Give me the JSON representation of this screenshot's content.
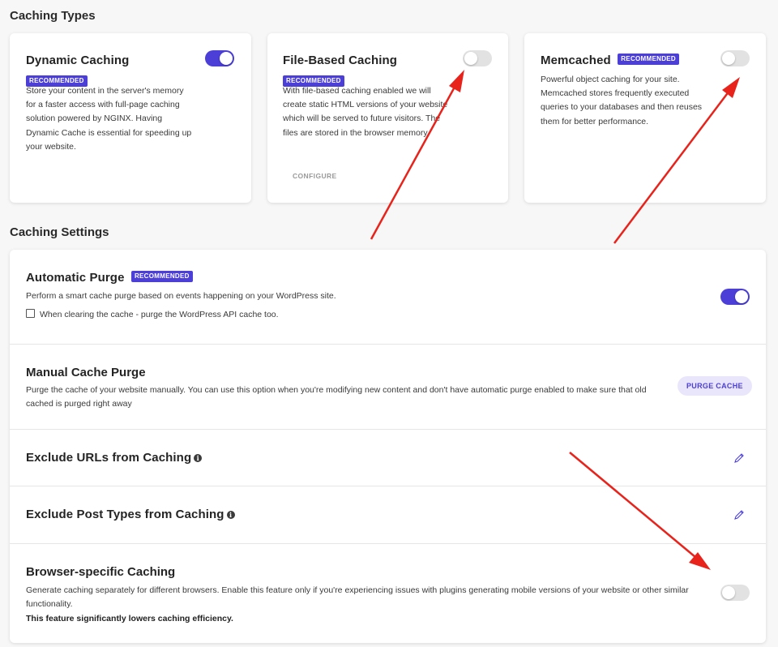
{
  "caching_types": {
    "heading": "Caching Types",
    "cards": [
      {
        "title": "Dynamic Caching",
        "badge": "RECOMMENDED",
        "description": "Store your content in the server's memory for a faster access with full-page caching solution powered by NGINX. Having Dynamic Cache is essential for speeding up your website.",
        "enabled": true
      },
      {
        "title": "File-Based Caching",
        "badge": "RECOMMENDED",
        "description": "With file-based caching enabled we will create static HTML versions of your website which will be served to future visitors. The files are stored in the browser memory.",
        "action_label": "CONFIGURE",
        "enabled": false
      },
      {
        "title": "Memcached",
        "badge": "RECOMMENDED",
        "description": "Powerful object caching for your site. Memcached stores frequently executed queries to your databases and then reuses them for better performance.",
        "enabled": false
      }
    ]
  },
  "caching_settings": {
    "heading": "Caching Settings",
    "automatic_purge": {
      "title": "Automatic Purge",
      "badge": "RECOMMENDED",
      "description": "Perform a smart cache purge based on events happening on your WordPress site.",
      "checkbox_label": "When clearing the cache - purge the WordPress API cache too.",
      "checkbox_checked": false,
      "enabled": true
    },
    "manual_purge": {
      "title": "Manual Cache Purge",
      "description": "Purge the cache of your website manually. You can use this option when you're modifying new content and don't have automatic purge enabled to make sure that old cached is purged right away",
      "button_label": "PURGE CACHE"
    },
    "exclude_urls": {
      "title": "Exclude URLs from Caching"
    },
    "exclude_post_types": {
      "title": "Exclude Post Types from Caching"
    },
    "browser_specific": {
      "title": "Browser-specific Caching",
      "description": "Generate caching separately for different browsers. Enable this feature only if you're experiencing issues with plugins generating mobile versions of your website or other similar functionality.",
      "warning": "This feature significantly lowers caching efficiency.",
      "enabled": false
    }
  },
  "colors": {
    "accent": "#4b3fd8",
    "annotation_arrow": "#e8231b"
  },
  "icons": {
    "info": "info-icon",
    "edit": "pencil-icon"
  }
}
